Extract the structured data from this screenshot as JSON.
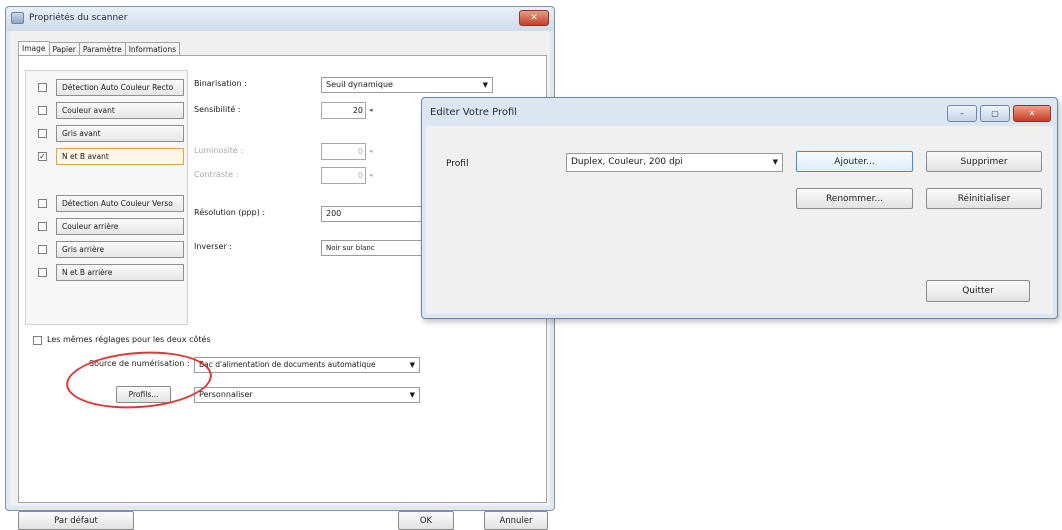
{
  "main": {
    "title": "Propriétés du scanner",
    "close": "✕",
    "tabs": [
      "Image",
      "Papier",
      "Paramètre",
      "Informations"
    ],
    "toggles": [
      {
        "label": "Détection Auto Couleur Recto",
        "checked": false
      },
      {
        "label": "Couleur avant",
        "checked": false
      },
      {
        "label": "Gris avant",
        "checked": false
      },
      {
        "label": "N et B avant",
        "checked": true
      },
      {
        "label": "Détection Auto Couleur Verso",
        "checked": false
      },
      {
        "label": "Couleur arrière",
        "checked": false
      },
      {
        "label": "Gris arrière",
        "checked": false
      },
      {
        "label": "N et B arrière",
        "checked": false
      }
    ],
    "settings": {
      "binarisation_label": "Binarisation :",
      "binarisation_value": "Seuil dynamique",
      "sensibilite_label": "Sensibilité :",
      "sensibilite_value": "20",
      "luminosite_label": "Luminosité :",
      "luminosite_value": "0",
      "contraste_label": "Contraste :",
      "contraste_value": "0",
      "resolution_label": "Résolution (ppp) :",
      "resolution_value": "200",
      "inverser_label": "Inverser :",
      "inverser_value": "Noir sur blanc"
    },
    "same_settings_label": "Les mêmes réglages pour les deux côtés",
    "source_label": "Source de numérisation :",
    "source_value": "Bac d'alimentation de documents automatique",
    "profils_button": "Profils...",
    "profils_value": "Personnaliser",
    "default_button": "Par défaut",
    "ok_button": "OK",
    "cancel_button": "Annuler"
  },
  "dialog": {
    "title": "Editer Votre Profil",
    "profil_label": "Profil",
    "profil_value": "Duplex, Couleur, 200 dpi",
    "add_button": "Ajouter...",
    "delete_button": "Supprimer",
    "rename_button": "Renommer...",
    "reset_button": "Réinitialiser",
    "quit_button": "Quitter",
    "min_glyph": "–",
    "max_glyph": "▢",
    "close_glyph": "✕"
  },
  "colors": {
    "title_bar": "#cfdbe8",
    "close_button": "#c63c24",
    "highlight_circle": "#d83a3a",
    "selected_toggle_border": "#e0a24a"
  }
}
